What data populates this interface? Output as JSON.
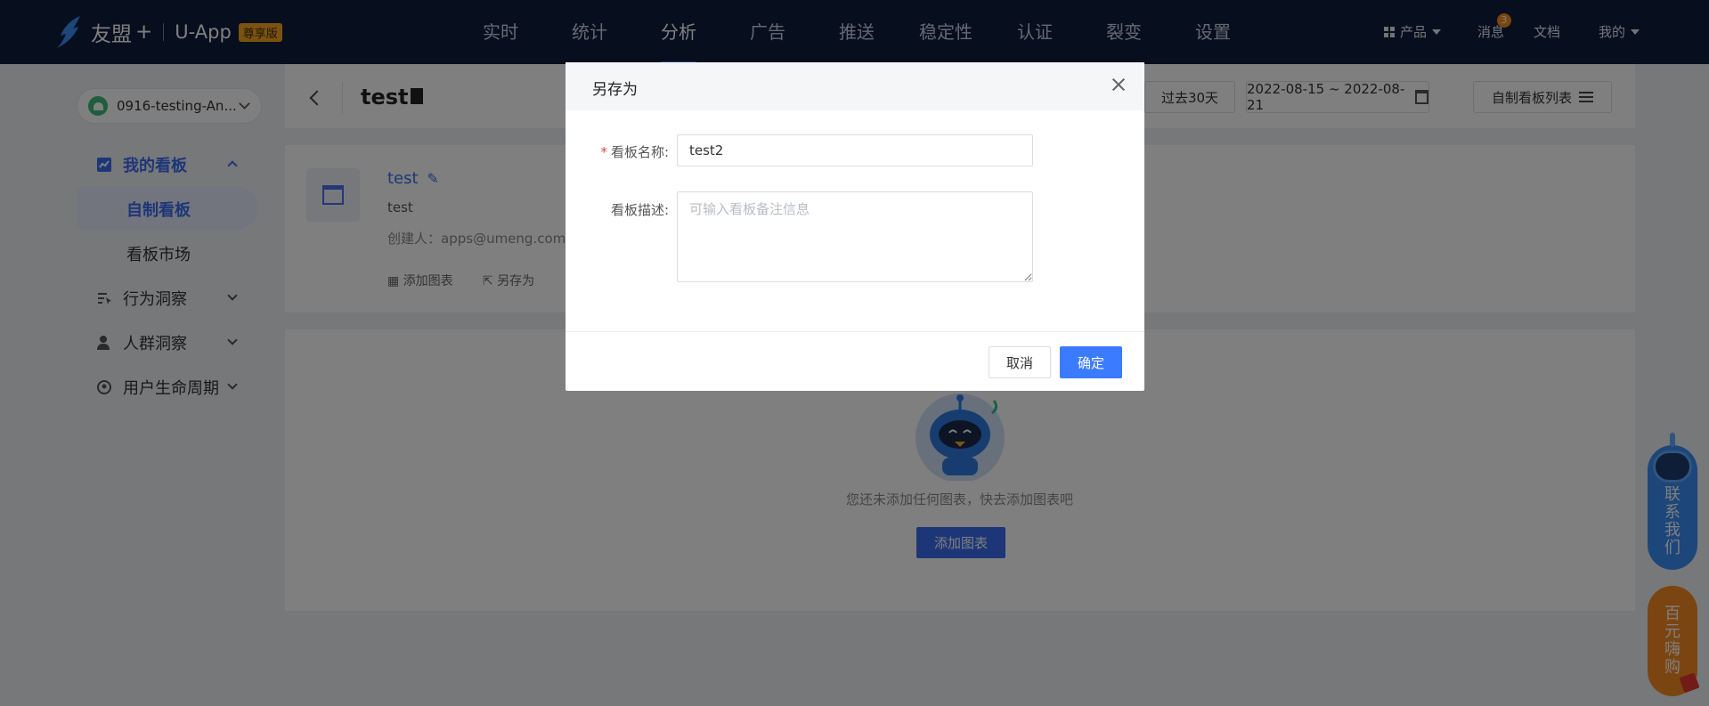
{
  "brand": {
    "name": "友盟",
    "plus": "+",
    "product": "U-App",
    "edition": "尊享版"
  },
  "nav": {
    "items": [
      "实时",
      "统计",
      "分析",
      "广告",
      "推送",
      "稳定性",
      "认证",
      "裂变",
      "设置"
    ],
    "active": "分析"
  },
  "topright": {
    "products": "产品",
    "messages": "消息",
    "message_count": "3",
    "docs": "文档",
    "mine": "我的"
  },
  "app_selector": {
    "value": "0916-testing-An..."
  },
  "sidebar": {
    "my_boards": "我的看板",
    "custom_board": "自制看板",
    "board_market": "看板市场",
    "behavior": "行为洞察",
    "crowd": "人群洞察",
    "lifecycle": "用户生命周期"
  },
  "header": {
    "title": "test",
    "range_btn": "过去30天",
    "date_range": "2022-08-15 ~ 2022-08-21",
    "board_list": "自制看板列表"
  },
  "dashboard": {
    "name": "test",
    "description": "test",
    "creator_label": "创建人：",
    "creator": "apps@umeng.com",
    "add_chart": "添加图表",
    "save_as": "另存为"
  },
  "empty": {
    "text": "您还未添加任何图表，快去添加图表吧",
    "button": "添加图表"
  },
  "floating": {
    "contact": "联系我们",
    "promo": "百元嗨购"
  },
  "modal": {
    "title": "另存为",
    "name_label": "看板名称:",
    "name_value": "test2",
    "desc_label": "看板描述:",
    "desc_placeholder": "可输入看板备注信息",
    "cancel": "取消",
    "ok": "确定"
  },
  "colors": {
    "topbar": "#0f1d3c",
    "accent": "#3b7bff",
    "required": "#e64545"
  }
}
